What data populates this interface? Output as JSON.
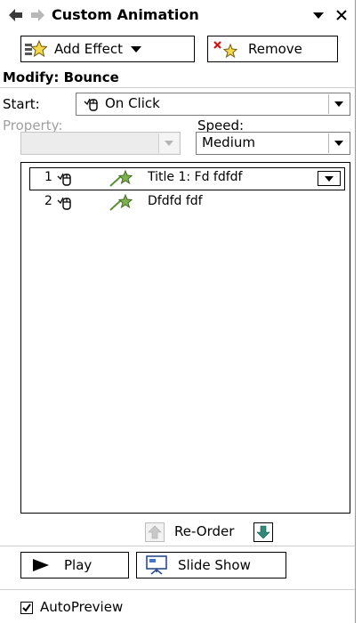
{
  "pane": {
    "title": "Custom Animation",
    "icons": {
      "back": "back-arrow-icon",
      "forward": "forward-arrow-icon",
      "menu": "pane-menu-icon",
      "close": "close-icon"
    }
  },
  "toolbar": {
    "add_effect_label": "Add Effect",
    "remove_label": "Remove"
  },
  "modify": {
    "label": "Modify: Bounce"
  },
  "start": {
    "label": "Start:",
    "value": "On Click"
  },
  "property": {
    "label": "Property:",
    "value": ""
  },
  "speed": {
    "label": "Speed:",
    "value": "Medium"
  },
  "effects": [
    {
      "num": "1",
      "text": "Title 1: Fd  fdfdf",
      "selected": true
    },
    {
      "num": "2",
      "text": "Dfdfd fdf",
      "selected": false
    }
  ],
  "reorder": {
    "label": "Re-Order"
  },
  "playback": {
    "play_label": "Play",
    "slideshow_label": "Slide Show"
  },
  "autopreview": {
    "label": "AutoPreview",
    "checked": true
  }
}
